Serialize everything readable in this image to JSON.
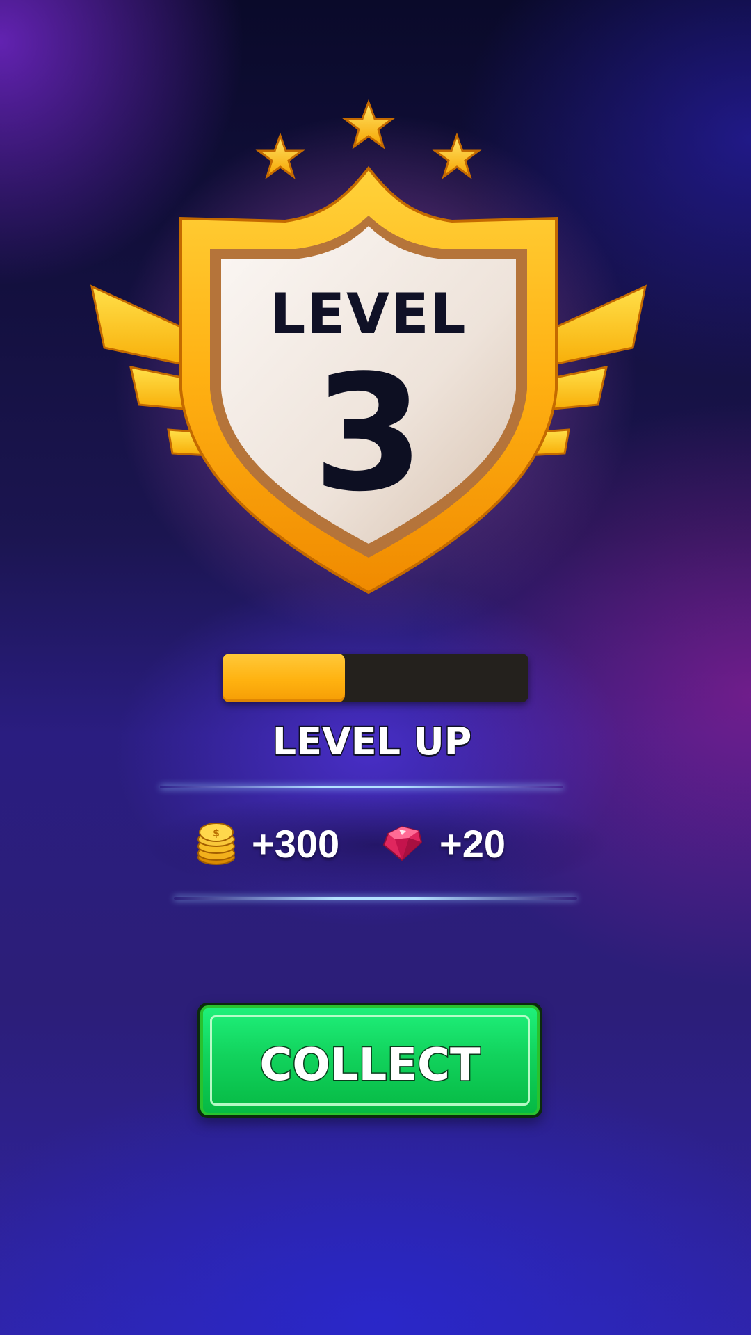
{
  "badge": {
    "label": "LEVEL",
    "level_number": "3",
    "stars": 3
  },
  "progress": {
    "fraction": 0.4
  },
  "status": {
    "text": "LEVEL UP"
  },
  "rewards": [
    {
      "icon": "coin-stack-icon",
      "value": "+300"
    },
    {
      "icon": "gem-icon",
      "value": "+20"
    }
  ],
  "actions": {
    "collect_label": "COLLECT"
  },
  "colors": {
    "gold": "#ffb210",
    "button_green": "#12d35d",
    "text_dark": "#101126"
  }
}
